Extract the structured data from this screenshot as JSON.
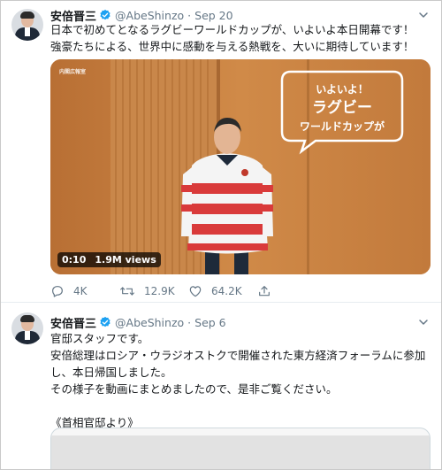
{
  "tweets": [
    {
      "name": "安倍晋三",
      "handle": "@AbeShinzo",
      "separator": "·",
      "date": "Sep 20",
      "text": "日本で初めてとなるラグビーワールドカップが、いよいよ本日開幕です！\n強豪たちによる、世界中に感動を与える熱戦を、大いに期待しています！",
      "video": {
        "duration": "0:10",
        "views": "1.9M views",
        "overlay_text": [
          "いよいよ！",
          "ラグビー",
          "ワールドカップが"
        ],
        "channel_logo": "内閣広報室"
      },
      "actions": {
        "replies": "4K",
        "retweets": "12.9K",
        "likes": "64.2K"
      }
    },
    {
      "name": "安倍晋三",
      "handle": "@AbeShinzo",
      "separator": "·",
      "date": "Sep 6",
      "text": "官邸スタッフです。\n安倍総理はロシア・ウラジオストクで開催された東方経済フォーラムに参加し、本日帰国しました。\nその様子を動画にまとめましたので、是非ご覧ください。\n\n《首相官邸より》"
    }
  ],
  "icons": {
    "verified": "verified-badge-icon",
    "caret": "chevron-down-icon",
    "reply": "reply-icon",
    "retweet": "retweet-icon",
    "like": "heart-icon",
    "share": "share-icon"
  },
  "colors": {
    "verified_blue": "#1da1f2",
    "secondary_text": "#657786",
    "primary_text": "#14171a"
  }
}
